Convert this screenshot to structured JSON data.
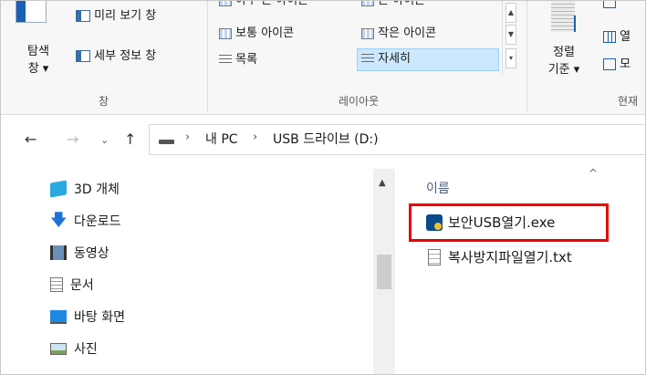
{
  "ribbon": {
    "panes": {
      "nav_pane_label": "탐색\n창 ▾",
      "preview_pane_label": "미리 보기 창",
      "details_pane_label": "세부 정보 창",
      "group_label": "창"
    },
    "layout": {
      "items": [
        "아주 큰 아이콘",
        "큰 아이콘",
        "보통 아이콘",
        "작은 아이콘",
        "목록",
        "자세히"
      ],
      "group_label": "레이아웃"
    },
    "current_view": {
      "sort_label": "정렬\n기준 ▾",
      "add_columns_label": "열",
      "fit_columns_label": "모",
      "group_label": "현재"
    }
  },
  "address": {
    "path": [
      "내 PC",
      "USB 드라이브 (D:)"
    ]
  },
  "nav_pane": {
    "items": [
      {
        "label": "3D 개체",
        "icon": "3d-objects-icon"
      },
      {
        "label": "다운로드",
        "icon": "download-icon"
      },
      {
        "label": "동영상",
        "icon": "video-icon"
      },
      {
        "label": "문서",
        "icon": "documents-icon"
      },
      {
        "label": "바탕 화면",
        "icon": "desktop-icon"
      },
      {
        "label": "사진",
        "icon": "pictures-icon"
      }
    ]
  },
  "content": {
    "column_header": "이름",
    "files": [
      {
        "name": "보안USB열기.exe",
        "icon": "exe-icon"
      },
      {
        "name": "복사방지파일열기.txt",
        "icon": "text-file-icon"
      }
    ]
  },
  "colors": {
    "highlight": "#e60000",
    "selection": "#cce8ff"
  }
}
